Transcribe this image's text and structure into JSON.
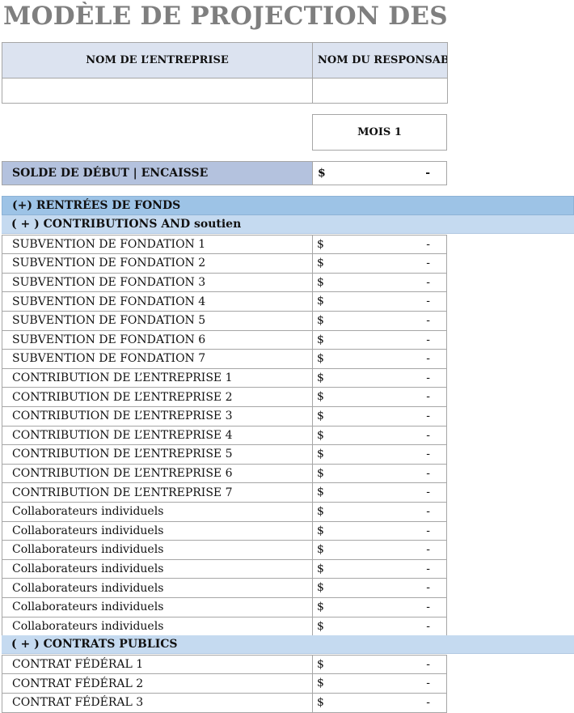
{
  "title": "MODÈLE DE PROJECTION DES FLUX D",
  "header": {
    "company_name_label": "NOM DE L’ENTREPRISE",
    "manager_name_label": "NOM DU RESPONSABLE",
    "company_name_value": "",
    "manager_name_value": ""
  },
  "month_label": "MOIS 1",
  "opening_balance": {
    "label": "SOLDE DE DÉBUT | ENCAISSE",
    "currency": "$",
    "value": "-"
  },
  "cash_in": {
    "label": "(+) RENTRÉES DE FONDS",
    "sections": [
      {
        "label": "( + ) CONTRIBUTIONS AND soutien",
        "rows": [
          {
            "label": "SUBVENTION DE FONDATION 1",
            "currency": "$",
            "value": "-"
          },
          {
            "label": "SUBVENTION DE FONDATION 2",
            "currency": "$",
            "value": "-"
          },
          {
            "label": "SUBVENTION DE FONDATION 3",
            "currency": "$",
            "value": "-"
          },
          {
            "label": "SUBVENTION DE FONDATION 4",
            "currency": "$",
            "value": "-"
          },
          {
            "label": "SUBVENTION DE FONDATION 5",
            "currency": "$",
            "value": "-"
          },
          {
            "label": "SUBVENTION DE FONDATION 6",
            "currency": "$",
            "value": "-"
          },
          {
            "label": "SUBVENTION DE FONDATION 7",
            "currency": "$",
            "value": "-"
          },
          {
            "label": "CONTRIBUTION DE L’ENTREPRISE 1",
            "currency": "$",
            "value": "-"
          },
          {
            "label": "CONTRIBUTION DE L’ENTREPRISE 2",
            "currency": "$",
            "value": "-"
          },
          {
            "label": "CONTRIBUTION DE L’ENTREPRISE 3",
            "currency": "$",
            "value": "-"
          },
          {
            "label": "CONTRIBUTION DE L’ENTREPRISE 4",
            "currency": "$",
            "value": "-"
          },
          {
            "label": "CONTRIBUTION DE L’ENTREPRISE 5",
            "currency": "$",
            "value": "-"
          },
          {
            "label": "CONTRIBUTION DE L’ENTREPRISE 6",
            "currency": "$",
            "value": "-"
          },
          {
            "label": "CONTRIBUTION DE L’ENTREPRISE 7",
            "currency": "$",
            "value": "-"
          },
          {
            "label": "Collaborateurs individuels",
            "currency": "$",
            "value": "-"
          },
          {
            "label": "Collaborateurs individuels",
            "currency": "$",
            "value": "-"
          },
          {
            "label": "Collaborateurs individuels",
            "currency": "$",
            "value": "-"
          },
          {
            "label": "Collaborateurs individuels",
            "currency": "$",
            "value": "-"
          },
          {
            "label": "Collaborateurs individuels",
            "currency": "$",
            "value": "-"
          },
          {
            "label": "Collaborateurs individuels",
            "currency": "$",
            "value": "-"
          },
          {
            "label": "Collaborateurs individuels",
            "currency": "$",
            "value": "-"
          }
        ]
      },
      {
        "label": "( + ) CONTRATS PUBLICS",
        "rows": [
          {
            "label": "CONTRAT FÉDÉRAL 1",
            "currency": "$",
            "value": "-"
          },
          {
            "label": "CONTRAT FÉDÉRAL 2",
            "currency": "$",
            "value": "-"
          },
          {
            "label": "CONTRAT FÉDÉRAL 3",
            "currency": "$",
            "value": "-"
          }
        ]
      }
    ]
  }
}
